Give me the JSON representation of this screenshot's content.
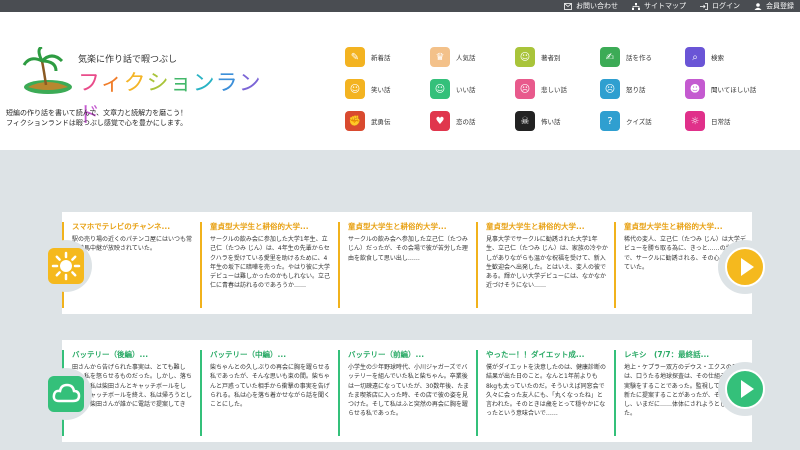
{
  "topnav": [
    {
      "label": "お問い合わせ",
      "icon": "mail-icon"
    },
    {
      "label": "サイトマップ",
      "icon": "sitemap-icon"
    },
    {
      "label": "ログイン",
      "icon": "login-icon"
    },
    {
      "label": "会員登録",
      "icon": "user-icon"
    }
  ],
  "logo": {
    "tagline": "気楽に作り話で暇つぶし",
    "title_chars": [
      "フ",
      "ィ",
      "ク",
      "シ",
      "ョ",
      "ン",
      "ラ",
      "ン",
      "ド"
    ],
    "title_colors": [
      "#e94c8a",
      "#f07d2a",
      "#f4b528",
      "#a9c43a",
      "#43b86a",
      "#29b3c4",
      "#3c8fd9",
      "#7b65d6",
      "#c45ad0"
    ]
  },
  "description": [
    "短編の作り話を書いて読んで、文章力と読解力を磨こう！",
    "フィクションランドは暇つぶし感覚で心を豊かにします。"
  ],
  "genres": [
    {
      "label": "新着話",
      "color": "#f3b321",
      "glyph": "✎"
    },
    {
      "label": "人気話",
      "color": "#f3c18a",
      "glyph": "♛"
    },
    {
      "label": "著者別",
      "color": "#a9c43a",
      "glyph": "☺"
    },
    {
      "label": "話を作る",
      "color": "#3cab56",
      "glyph": "✍"
    },
    {
      "label": "検索",
      "color": "#6a55d6",
      "glyph": "⌕"
    },
    {
      "label": "笑い話",
      "color": "#f3b321",
      "glyph": "☺"
    },
    {
      "label": "いい話",
      "color": "#34c07a",
      "glyph": "☺"
    },
    {
      "label": "悲しい話",
      "color": "#e85a8c",
      "glyph": "☹"
    },
    {
      "label": "怒り話",
      "color": "#2f9fd0",
      "glyph": "☹"
    },
    {
      "label": "聞いてほしい話",
      "color": "#c45ad0",
      "glyph": "☻"
    },
    {
      "label": "武勇伝",
      "color": "#d94a2f",
      "glyph": "✊"
    },
    {
      "label": "恋の話",
      "color": "#e0364d",
      "glyph": "♥"
    },
    {
      "label": "怖い話",
      "color": "#222222",
      "glyph": "☠"
    },
    {
      "label": "クイズ話",
      "color": "#2f9fd0",
      "glyph": "?"
    },
    {
      "label": "日常話",
      "color": "#e0308a",
      "glyph": "☼"
    }
  ],
  "rows": [
    {
      "badge_icon": "sun-icon",
      "cards": [
        {
          "title": "スマホでテレビのチャンネ...",
          "body": "駅の売り場の近くのパチンコ屋にはいつも常に競馬中継が放映されていた。"
        },
        {
          "title": "童貞型大学生と耕俗的大学...",
          "body": "サークルの飲み会に参加した大学1年生、立己仁（たつみ じん）は、4年生の先輩からセクハラを受けている愛里を助けるために、4年生の坂下に暗嘩を売った。やはり彼に大学デビューは難しかったのかもしれない。立己仁に青春は訪れるのであろうか……"
        },
        {
          "title": "童貞型大学生と耕俗的大学...",
          "body": "サークルの飲み会へ参加した立己仁（たつみ じん）だったが、その会場で彼が苦労した理由を飲食して思い出し……"
        },
        {
          "title": "童貞型大学生と耕俗的大学...",
          "body": "見事大学でサークルに勧誘された大学1年生、立己仁（たつみ じん）は、家族の冷やかしがありながらも温かな祝福を受けて、新入生歓迎会へ出発した。とはいえ、変人の彼である。輝かしい大学デビューには、なかなか近づけそうにない……"
        },
        {
          "title": "童貞型大学生と耕俗的大学...",
          "body": "稀代の変人、立己仁（たつみ じん）は大学デビューを勝ち取る為に、きっと……の世界で、サークルに勧誘される、その心は高鳴っていた。"
        }
      ]
    },
    {
      "badge_icon": "cloud-icon",
      "cards": [
        {
          "title": "バッテリー（後編）...",
          "body": "田さんから告げられた事実は、とても難しく、私を怒らせるものだった。しかし、落ち着いた私は柴田さんとキャッチボールをした。キャッチボールを終え、私は帰ろうとした時、柴田さんが誰かに電話で提案してきた。"
        },
        {
          "title": "バッテリー（中編）...",
          "body": "柴ちゃんとの久しぶりの再会に胸を躍らせる私であったが、そんな思いも束の間。柴ちゃんと戸惑っていた相手から衝撃の事実を告げられる。私は心を落ち着かせながら話を聞くことにした。"
        },
        {
          "title": "バッテリー（前編）...",
          "body": "小学生の少年野球時代、小川ジャガーズでバッテリーを組んでいた私と柴ちゃん。卒業後は一切疎遠になっていたが、30数年後、たまたま喫茶店に入った時、その店で彼の姿を見つけた。そして私はふと突然の再会に胸を躍らせる私であった。"
        },
        {
          "title": "やったー！！ダイエット成...",
          "body": "僕がダイエットを決意したのは、健康診断の結果が出た日のこと。なんと1年前よりも8kgも太っていたのだ。そういえば同窓会で久々に会った友人にも、「丸くなったね」と言われた。そのときは歳をとって穏やかになったという意味合いで……"
        },
        {
          "title": "レキシ　(7/7：最終話...",
          "body": "地上・ケプラー双方のデウス・エクスの目的は、口うたる地球探査は、その仕組み換えの実験をすることであった。監視しては全てが新たに提案することがあったが、それを拒否し、いまだに……体体にされようとしていた。"
        }
      ]
    }
  ]
}
